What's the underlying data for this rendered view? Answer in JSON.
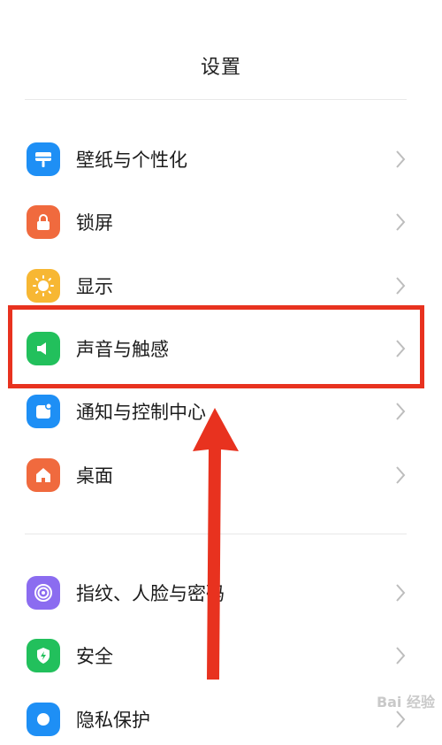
{
  "header": {
    "title": "设置"
  },
  "settings": [
    {
      "label": "壁纸与个性化",
      "icon": "wallpaper-icon",
      "color": "#1e8ff5"
    },
    {
      "label": "锁屏",
      "icon": "lock-icon",
      "color": "#f06a3e"
    },
    {
      "label": "显示",
      "icon": "sun-icon",
      "color": "#f7b733"
    },
    {
      "label": "声音与触感",
      "icon": "speaker-icon",
      "color": "#22c05c"
    },
    {
      "label": "通知与控制中心",
      "icon": "notification-icon",
      "color": "#1e8ff5"
    },
    {
      "label": "桌面",
      "icon": "home-icon",
      "color": "#f06a3e"
    },
    {
      "label": "指纹、人脸与密码",
      "icon": "fingerprint-icon",
      "color": "#8b6cf0"
    },
    {
      "label": "安全",
      "icon": "shield-icon",
      "color": "#22c05c"
    },
    {
      "label": "隐私保护",
      "icon": "privacy-icon",
      "color": "#1e8ff5"
    }
  ],
  "annotation": {
    "highlight_color": "#e8321f"
  },
  "watermark": {
    "text": "Bai 经验"
  }
}
